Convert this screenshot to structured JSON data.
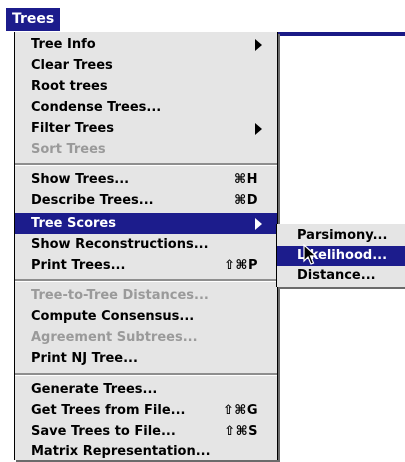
{
  "menu_title": "Trees",
  "menu_items": [
    {
      "label": "Tree Info",
      "submenu": true
    },
    {
      "label": "Clear Trees"
    },
    {
      "label": "Root trees"
    },
    {
      "label": "Condense Trees..."
    },
    {
      "label": "Filter Trees",
      "submenu": true
    },
    {
      "label": "Sort Trees",
      "disabled": true
    },
    {
      "label": "Show Trees...",
      "shortcut": "⌘H"
    },
    {
      "label": "Describe Trees...",
      "shortcut": "⌘D"
    },
    {
      "label": "Tree Scores",
      "submenu": true,
      "selected": true
    },
    {
      "label": "Show Reconstructions..."
    },
    {
      "label": "Print Trees...",
      "shortcut": "⇧⌘P"
    },
    {
      "label": "Tree-to-Tree Distances...",
      "disabled": true
    },
    {
      "label": "Compute Consensus..."
    },
    {
      "label": "Agreement Subtrees...",
      "disabled": true
    },
    {
      "label": "Print NJ Tree..."
    },
    {
      "label": "Generate Trees..."
    },
    {
      "label": "Get Trees from File...",
      "shortcut": "⇧⌘G"
    },
    {
      "label": "Save Trees to File...",
      "shortcut": "⇧⌘S"
    },
    {
      "label": "Matrix Representation..."
    }
  ],
  "submenu_items": [
    {
      "label": "Parsimony..."
    },
    {
      "label": "Likelihood...",
      "selected": true
    },
    {
      "label": "Distance..."
    }
  ],
  "colors": {
    "selection": "#1c1c8c",
    "menu_background": "#e5e5e5",
    "disabled_text": "#9a9a9a"
  },
  "cursor_icon": "arrow-pointer-icon"
}
